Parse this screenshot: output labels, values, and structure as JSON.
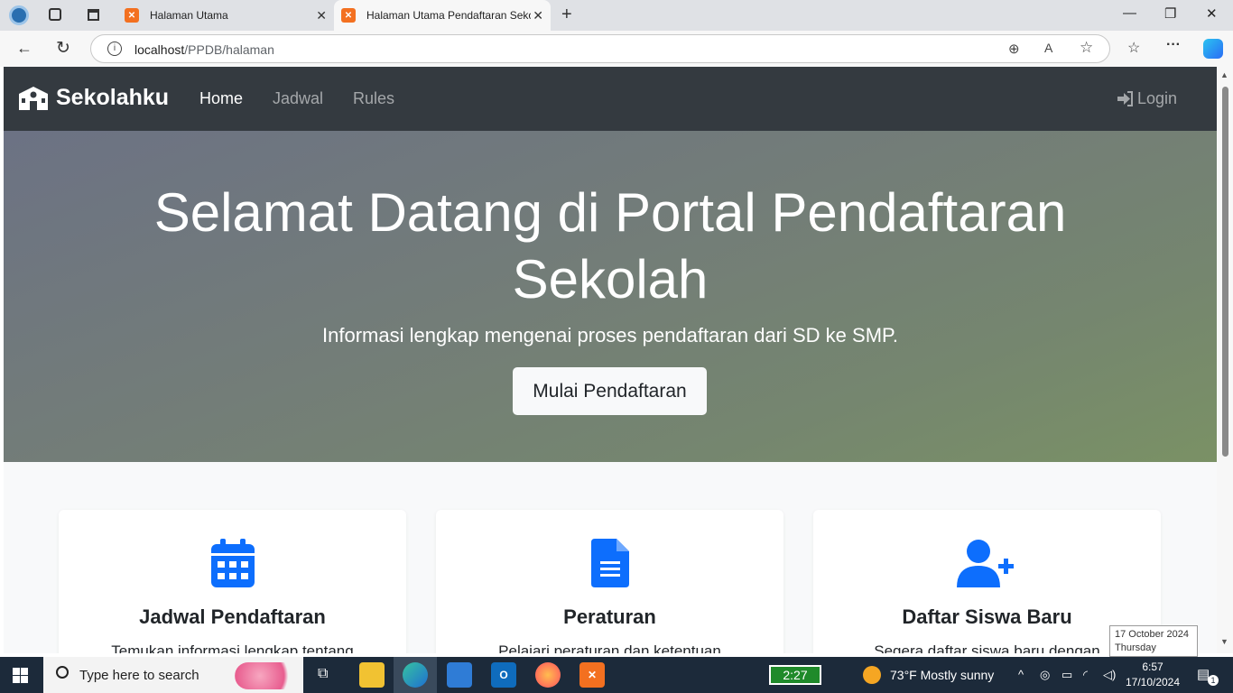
{
  "browser": {
    "tabs": [
      {
        "title": "Halaman Utama"
      },
      {
        "title": "Halaman Utama Pendaftaran Sekol"
      }
    ],
    "url_host": "localhost",
    "url_path": "/PPDB/halaman"
  },
  "navbar": {
    "brand": "Sekolahku",
    "links": [
      "Home",
      "Jadwal",
      "Rules"
    ],
    "login": "Login"
  },
  "hero": {
    "title": "Selamat Datang di Portal Pendaftaran Sekolah",
    "subtitle": "Informasi lengkap mengenai proses pendaftaran dari SD ke SMP.",
    "button": "Mulai Pendaftaran"
  },
  "cards": [
    {
      "icon": "calendar-icon",
      "title": "Jadwal Pendaftaran",
      "desc": "Temukan informasi lengkap tentang"
    },
    {
      "icon": "document-icon",
      "title": "Peraturan",
      "desc": "Pelajari peraturan dan ketentuan"
    },
    {
      "icon": "user-plus-icon",
      "title": "Daftar Siswa Baru",
      "desc": "Segera daftar siswa baru dengan"
    }
  ],
  "tooltip": {
    "date": "17 October 2024",
    "day": "Thursday"
  },
  "taskbar": {
    "search_placeholder": "Type here to search",
    "battery": "2:27",
    "weather": "73°F  Mostly sunny",
    "time": "6:57",
    "date": "17/10/2024",
    "notifications": "1"
  },
  "colors": {
    "navbar": "#343a40",
    "accent": "#0d6efd"
  }
}
